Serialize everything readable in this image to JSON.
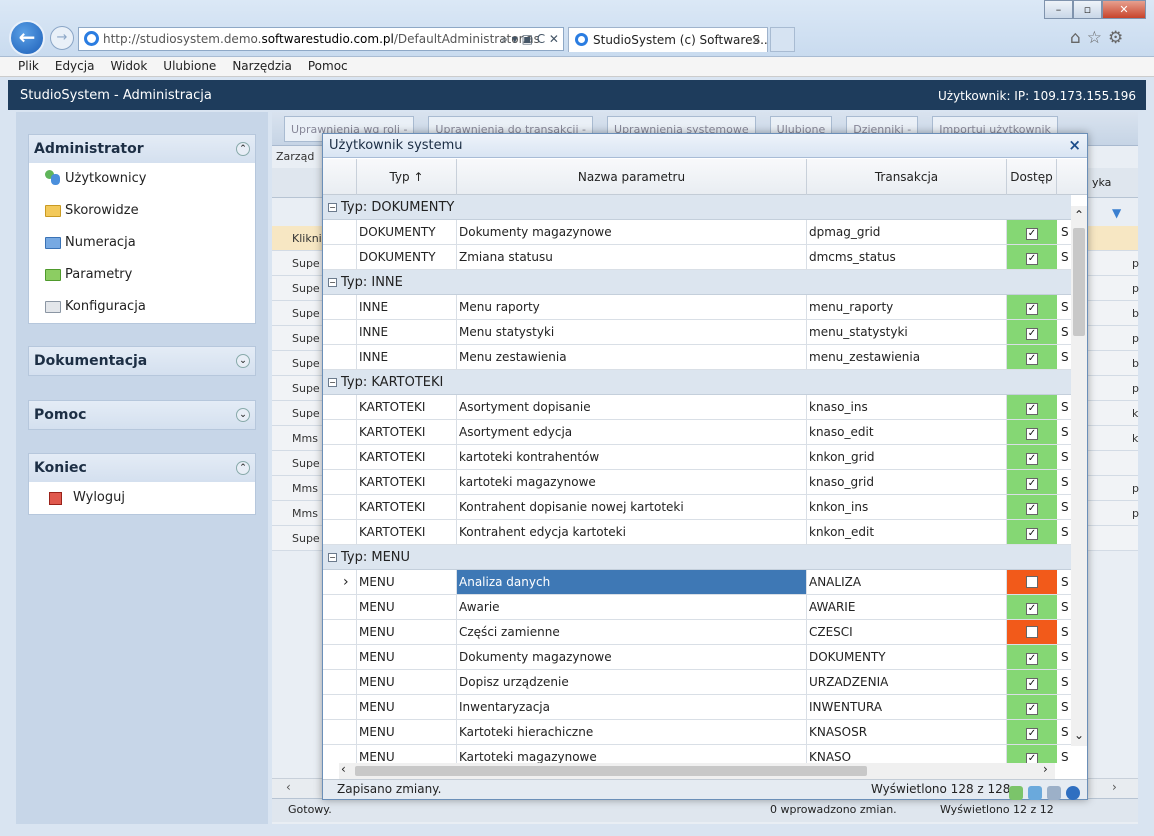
{
  "browser": {
    "url_prefix": "http://studiosystem.demo.",
    "url_host": "softwarestudio.com.pl",
    "url_suffix": "/DefaultAdministrator.as",
    "tab_title": "StudioSystem (c) SoftwareS...",
    "tab_close": "×",
    "menu": [
      "Plik",
      "Edycja",
      "Widok",
      "Ulubione",
      "Narzędzia",
      "Pomoc"
    ]
  },
  "app": {
    "title": "StudioSystem - Administracja",
    "user": "Użytkownik: IP: 109.173.155.196"
  },
  "sidebar": {
    "administrator": {
      "title": "Administrator",
      "items": [
        "Użytkownicy",
        "Skorowidze",
        "Numeracja",
        "Parametry",
        "Konfiguracja"
      ]
    },
    "dokumentacja": {
      "title": "Dokumentacja"
    },
    "pomoc": {
      "title": "Pomoc"
    },
    "koniec": {
      "title": "Koniec",
      "items": [
        "Wyloguj"
      ]
    }
  },
  "background": {
    "toolbar": [
      "Uprawnienia wg roli -",
      "Uprawnienia do transakcji -",
      "Uprawnienia systemowe",
      "Ulubione",
      "Dzienniki -",
      "Importuj użytkownik"
    ],
    "zarzadzanie": "Zarząd",
    "header_right": "yka",
    "klik": "Klikni",
    "rows": [
      {
        "a": "Supe",
        "r": "p"
      },
      {
        "a": "Supe",
        "r": "p"
      },
      {
        "a": "Supe",
        "r": "b"
      },
      {
        "a": "Supe",
        "r": "p"
      },
      {
        "a": "Supe",
        "r": "b"
      },
      {
        "a": "Supe",
        "r": "p"
      },
      {
        "a": "Supe",
        "r": "k"
      },
      {
        "a": "Mms",
        "r": "k"
      },
      {
        "a": "Supe",
        "r": ""
      },
      {
        "a": "Mms",
        "r": "p"
      },
      {
        "a": "Mms",
        "r": "p"
      },
      {
        "a": "Supe",
        "r": ""
      }
    ],
    "status_left": "Gotowy.",
    "status_changes": "0 wprowadzono zmian.",
    "status_count": "Wyświetlono 12 z 12"
  },
  "modal": {
    "title": "Użytkownik systemu",
    "close": "×",
    "columns": {
      "typ": "Typ ↑",
      "nazwa": "Nazwa parametru",
      "transakcja": "Transakcja",
      "dostep": "Dostęp"
    },
    "groups": [
      {
        "label": "Typ: DOKUMENTY",
        "rows": [
          {
            "typ": "DOKUMENTY",
            "nazwa": "Dokumenty magazynowe",
            "trans": "dpmag_grid",
            "on": true
          },
          {
            "typ": "DOKUMENTY",
            "nazwa": "Zmiana statusu",
            "trans": "dmcms_status",
            "on": true
          }
        ]
      },
      {
        "label": "Typ: INNE",
        "rows": [
          {
            "typ": "INNE",
            "nazwa": "Menu raporty",
            "trans": "menu_raporty",
            "on": true
          },
          {
            "typ": "INNE",
            "nazwa": "Menu statystyki",
            "trans": "menu_statystyki",
            "on": true
          },
          {
            "typ": "INNE",
            "nazwa": "Menu zestawienia",
            "trans": "menu_zestawienia",
            "on": true
          }
        ]
      },
      {
        "label": "Typ: KARTOTEKI",
        "rows": [
          {
            "typ": "KARTOTEKI",
            "nazwa": "Asortyment dopisanie",
            "trans": "knaso_ins",
            "on": true
          },
          {
            "typ": "KARTOTEKI",
            "nazwa": "Asortyment edycja",
            "trans": "knaso_edit",
            "on": true
          },
          {
            "typ": "KARTOTEKI",
            "nazwa": "kartoteki kontrahentów",
            "trans": "knkon_grid",
            "on": true
          },
          {
            "typ": "KARTOTEKI",
            "nazwa": "kartoteki magazynowe",
            "trans": "knaso_grid",
            "on": true
          },
          {
            "typ": "KARTOTEKI",
            "nazwa": "Kontrahent dopisanie nowej kartoteki",
            "trans": "knkon_ins",
            "on": true
          },
          {
            "typ": "KARTOTEKI",
            "nazwa": "Kontrahent edycja kartoteki",
            "trans": "knkon_edit",
            "on": true
          }
        ]
      },
      {
        "label": "Typ: MENU",
        "rows": [
          {
            "typ": "MENU",
            "nazwa": "Analiza danych",
            "trans": "ANALIZA",
            "on": false,
            "selected": true
          },
          {
            "typ": "MENU",
            "nazwa": "Awarie",
            "trans": "AWARIE",
            "on": true
          },
          {
            "typ": "MENU",
            "nazwa": "Części zamienne",
            "trans": "CZESCI",
            "on": false
          },
          {
            "typ": "MENU",
            "nazwa": "Dokumenty magazynowe",
            "trans": "DOKUMENTY",
            "on": true
          },
          {
            "typ": "MENU",
            "nazwa": "Dopisz urządzenie",
            "trans": "URZADZENIA",
            "on": true
          },
          {
            "typ": "MENU",
            "nazwa": "Inwentaryzacja",
            "trans": "INWENTURA",
            "on": true
          },
          {
            "typ": "MENU",
            "nazwa": "Kartoteki hierachiczne",
            "trans": "KNASOSR",
            "on": true
          },
          {
            "typ": "MENU",
            "nazwa": "Kartoteki magazynowe",
            "trans": "KNASO",
            "on": true
          }
        ]
      }
    ],
    "cut_col": "S",
    "status_left": "Zapisano zmiany.",
    "status_count": "Wyświetlono 128 z 128"
  }
}
